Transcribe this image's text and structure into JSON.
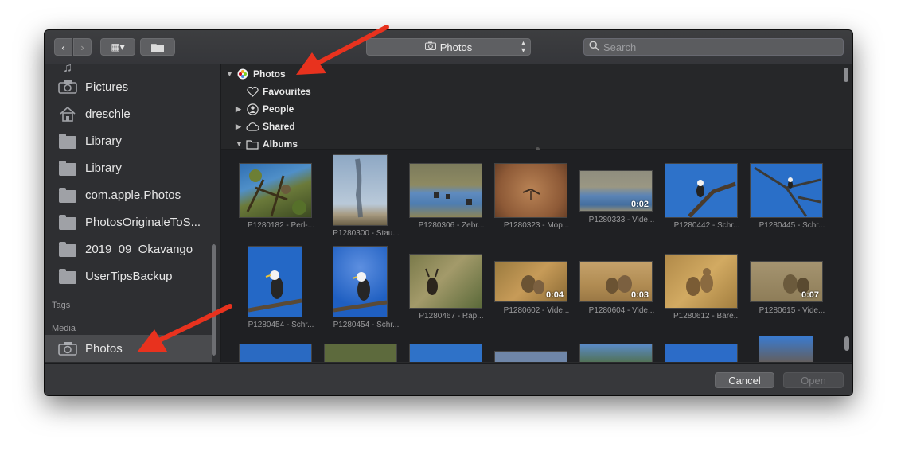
{
  "toolbar": {
    "back_glyph": "‹",
    "forward_glyph": "›",
    "view_glyph": "▦▾",
    "source_select": "Photos",
    "search_placeholder": "Search"
  },
  "sidebar": {
    "items": [
      {
        "label": "Pictures",
        "icon": "camera-icon"
      },
      {
        "label": "dreschle",
        "icon": "home-icon"
      },
      {
        "label": "Library",
        "icon": "folder-icon"
      },
      {
        "label": "Library",
        "icon": "folder-icon"
      },
      {
        "label": "com.apple.Photos",
        "icon": "folder-icon"
      },
      {
        "label": "PhotosOriginaleToS...",
        "icon": "folder-icon"
      },
      {
        "label": "2019_09_Okavango",
        "icon": "folder-icon"
      },
      {
        "label": "UserTipsBackup",
        "icon": "folder-icon"
      }
    ],
    "tags_header": "Tags",
    "media_header": "Media",
    "media_item": {
      "label": "Photos",
      "icon": "camera-icon",
      "selected": true
    }
  },
  "outline": {
    "rows": [
      {
        "label": "Photos",
        "expanded": true,
        "icon": "photos-app-icon"
      },
      {
        "label": "Favourites",
        "icon": "heart-icon"
      },
      {
        "label": "People",
        "expanded": false,
        "icon": "person-icon"
      },
      {
        "label": "Shared",
        "expanded": false,
        "icon": "cloud-icon"
      },
      {
        "label": "Albums",
        "expanded": true,
        "icon": "folder-icon"
      }
    ]
  },
  "photos": {
    "row1": [
      {
        "caption": "P1280182 - Perl-...",
        "duration": ""
      },
      {
        "caption": "P1280300 - Stau...",
        "duration": ""
      },
      {
        "caption": "P1280306 - Zebr...",
        "duration": ""
      },
      {
        "caption": "P1280323 - Mop...",
        "duration": ""
      },
      {
        "caption": "P1280333 - Vide...",
        "duration": "0:02"
      },
      {
        "caption": "P1280442 - Schr...",
        "duration": ""
      },
      {
        "caption": "P1280445 - Schr...",
        "duration": ""
      }
    ],
    "row2": [
      {
        "caption": "P1280454 - Schr...",
        "duration": ""
      },
      {
        "caption": "P1280454 - Schr...",
        "duration": ""
      },
      {
        "caption": "P1280467 - Rap...",
        "duration": ""
      },
      {
        "caption": "P1280602 - Vide...",
        "duration": "0:04"
      },
      {
        "caption": "P1280604 - Vide...",
        "duration": "0:03"
      },
      {
        "caption": "P1280612 - Bäre...",
        "duration": ""
      },
      {
        "caption": "P1280615 - Vide...",
        "duration": "0:07"
      }
    ]
  },
  "buttons": {
    "cancel": "Cancel",
    "open": "Open"
  },
  "colors": {
    "annotation_arrow": "#e8321e",
    "sidebar_selected": "#4a4b4e"
  }
}
